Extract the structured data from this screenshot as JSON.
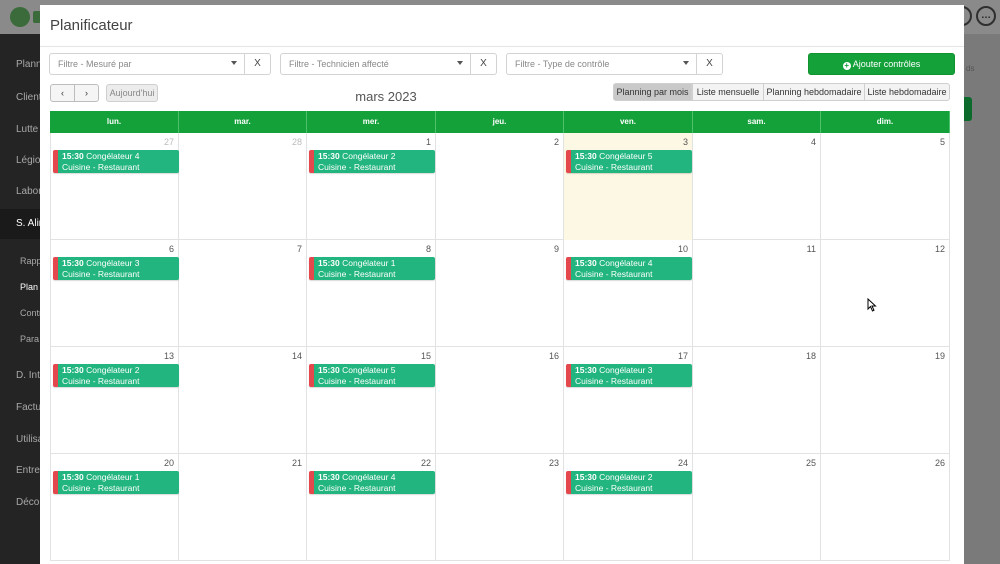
{
  "background": {
    "sidebar_items": [
      "Planni",
      "Client",
      "Lutte",
      "Légion",
      "Labora",
      "S. Alim",
      "Rapp",
      "Plan",
      "Contr",
      "Para",
      "D. Inte",
      "Factu",
      "Utilisa",
      "Entrep",
      "Déco"
    ],
    "right_text": "ds"
  },
  "modal": {
    "title": "Planificateur"
  },
  "filters": [
    {
      "placeholder": "Filtre - Mesuré par",
      "clear": "X"
    },
    {
      "placeholder": "Filtre - Technicien affecté",
      "clear": "X"
    },
    {
      "placeholder": "Filtre - Type de contrôle",
      "clear": "X"
    }
  ],
  "add_button": {
    "label": "Ajouter contrôles",
    "icon": "plus-circle-icon"
  },
  "nav": {
    "prev": "‹",
    "next": "›",
    "today": "Aujourd'hui"
  },
  "calendar_title": "mars 2023",
  "views": [
    {
      "label": "Planning par mois",
      "active": true
    },
    {
      "label": "Liste mensuelle",
      "active": false
    },
    {
      "label": "Planning hebdomadaire",
      "active": false
    },
    {
      "label": "Liste hebdomadaire",
      "active": false
    }
  ],
  "days_of_week": [
    "lun.",
    "mar.",
    "mer.",
    "jeu.",
    "ven.",
    "sam.",
    "dim."
  ],
  "weeks": [
    [
      {
        "n": "27",
        "other": true,
        "event": {
          "time": "15:30",
          "title": "Congélateur 4",
          "place": "Cuisine - Restaurant"
        }
      },
      {
        "n": "28",
        "other": true
      },
      {
        "n": "1",
        "event": {
          "time": "15:30",
          "title": "Congélateur 2",
          "place": "Cuisine - Restaurant"
        }
      },
      {
        "n": "2"
      },
      {
        "n": "3",
        "today": true,
        "event": {
          "time": "15:30",
          "title": "Congélateur 5",
          "place": "Cuisine - Restaurant"
        }
      },
      {
        "n": "4"
      },
      {
        "n": "5"
      }
    ],
    [
      {
        "n": "6",
        "event": {
          "time": "15:30",
          "title": "Congélateur 3",
          "place": "Cuisine - Restaurant"
        }
      },
      {
        "n": "7"
      },
      {
        "n": "8",
        "event": {
          "time": "15:30",
          "title": "Congélateur 1",
          "place": "Cuisine - Restaurant"
        }
      },
      {
        "n": "9"
      },
      {
        "n": "10",
        "event": {
          "time": "15:30",
          "title": "Congélateur 4",
          "place": "Cuisine - Restaurant"
        }
      },
      {
        "n": "11"
      },
      {
        "n": "12"
      }
    ],
    [
      {
        "n": "13",
        "event": {
          "time": "15:30",
          "title": "Congélateur 2",
          "place": "Cuisine - Restaurant"
        }
      },
      {
        "n": "14"
      },
      {
        "n": "15",
        "event": {
          "time": "15:30",
          "title": "Congélateur 5",
          "place": "Cuisine - Restaurant"
        }
      },
      {
        "n": "16"
      },
      {
        "n": "17",
        "event": {
          "time": "15:30",
          "title": "Congélateur 3",
          "place": "Cuisine - Restaurant"
        }
      },
      {
        "n": "18"
      },
      {
        "n": "19"
      }
    ],
    [
      {
        "n": "20",
        "event": {
          "time": "15:30",
          "title": "Congélateur 1",
          "place": "Cuisine - Restaurant"
        }
      },
      {
        "n": "21"
      },
      {
        "n": "22",
        "event": {
          "time": "15:30",
          "title": "Congélateur 4",
          "place": "Cuisine - Restaurant"
        }
      },
      {
        "n": "23"
      },
      {
        "n": "24",
        "event": {
          "time": "15:30",
          "title": "Congélateur 2",
          "place": "Cuisine - Restaurant"
        }
      },
      {
        "n": "25"
      },
      {
        "n": "26"
      }
    ]
  ],
  "colors": {
    "primary_green": "#14a13a",
    "event_green": "#22b57f",
    "event_marker": "#e4474c",
    "today_bg": "#fcf8e3"
  }
}
